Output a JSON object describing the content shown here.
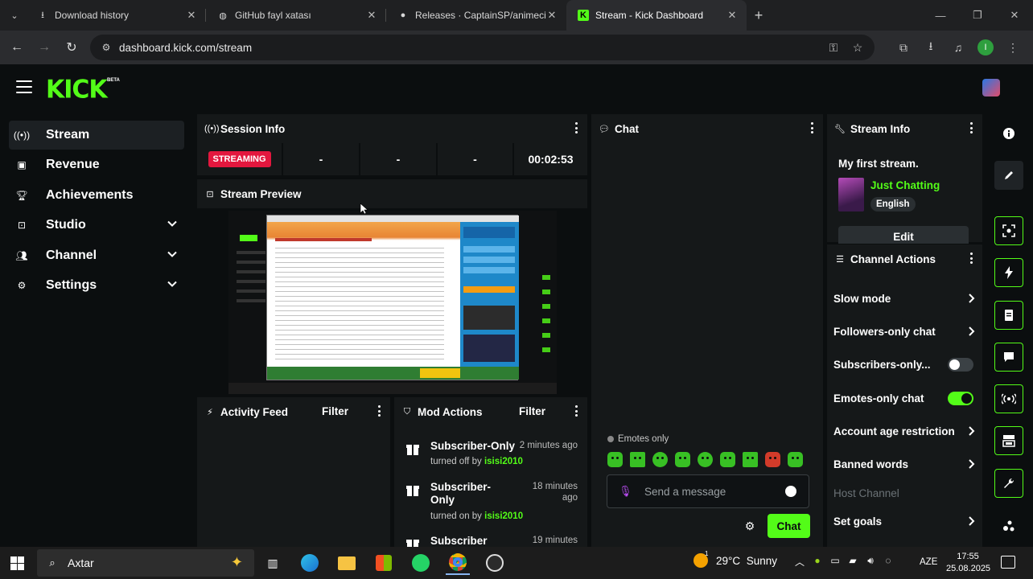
{
  "browser": {
    "tabs": [
      {
        "title": "Download history",
        "icon": "download-icon"
      },
      {
        "title": "GitHub fayl xatası",
        "icon": "globe-icon"
      },
      {
        "title": "Releases · CaptainSP/animecix-d",
        "icon": "github-icon"
      },
      {
        "title": "Stream - Kick Dashboard",
        "icon": "kick-icon"
      }
    ],
    "url": "dashboard.kick.com/stream",
    "profile_initial": "I"
  },
  "brand": {
    "logo": "KICK",
    "badge": "BETA",
    "accent": "#53fc18"
  },
  "sidebar": {
    "items": [
      {
        "label": "Stream",
        "icon": "broadcast-icon",
        "active": true,
        "expandable": false
      },
      {
        "label": "Revenue",
        "icon": "wallet-icon",
        "active": false,
        "expandable": false
      },
      {
        "label": "Achievements",
        "icon": "trophy-icon",
        "active": false,
        "expandable": false
      },
      {
        "label": "Studio",
        "icon": "studio-icon",
        "active": false,
        "expandable": true
      },
      {
        "label": "Channel",
        "icon": "users-icon",
        "active": false,
        "expandable": true
      },
      {
        "label": "Settings",
        "icon": "gear-icon",
        "active": false,
        "expandable": true
      }
    ]
  },
  "session_info": {
    "title": "Session Info",
    "status": "STREAMING",
    "stats": [
      "-",
      "-",
      "-"
    ],
    "duration": "00:02:53"
  },
  "stream_preview": {
    "title": "Stream Preview"
  },
  "activity_feed": {
    "title": "Activity Feed",
    "filter": "Filter"
  },
  "mod_actions": {
    "title": "Mod Actions",
    "filter": "Filter",
    "items": [
      {
        "title": "Subscriber-Only",
        "time": "2 minutes ago",
        "action": "turned off by",
        "user": "isisi2010"
      },
      {
        "title": "Subscriber-Only",
        "time": "18 minutes ago",
        "action": "turned on by",
        "user": "isisi2010"
      },
      {
        "title": "Subscriber",
        "time": "19 minutes",
        "action": "",
        "user": ""
      }
    ]
  },
  "chat": {
    "title": "Chat",
    "emotes_only_label": "Emotes only",
    "placeholder": "Send a message",
    "send_label": "Chat"
  },
  "stream_info": {
    "title": "Stream Info",
    "stream_title": "My first stream.",
    "category": "Just Chatting",
    "language": "English",
    "edit_label": "Edit"
  },
  "channel_actions": {
    "title": "Channel Actions",
    "items": [
      {
        "label": "Slow mode",
        "control": "chevron"
      },
      {
        "label": "Followers-only chat",
        "control": "chevron"
      },
      {
        "label": "Subscribers-only...",
        "control": "toggle",
        "on": false
      },
      {
        "label": "Emotes-only chat",
        "control": "toggle",
        "on": true
      },
      {
        "label": "Account age restriction",
        "control": "chevron"
      },
      {
        "label": "Banned words",
        "control": "chevron"
      },
      {
        "label": "Host Channel",
        "control": "none",
        "disabled": true
      },
      {
        "label": "Set goals",
        "control": "chevron"
      }
    ]
  },
  "right_rail": [
    "info-icon",
    "pencil-icon",
    "scan-icon",
    "bolt-icon",
    "note-icon",
    "chat-bubble-icon",
    "broadcast-icon",
    "layout-icon",
    "wrench-icon",
    "molecule-icon"
  ],
  "taskbar": {
    "search_placeholder": "Axtar",
    "weather_temp": "29°C",
    "weather_text": "Sunny",
    "weather_badge": "1",
    "language": "AZE",
    "time": "17:55",
    "date": "25.08.2025"
  }
}
